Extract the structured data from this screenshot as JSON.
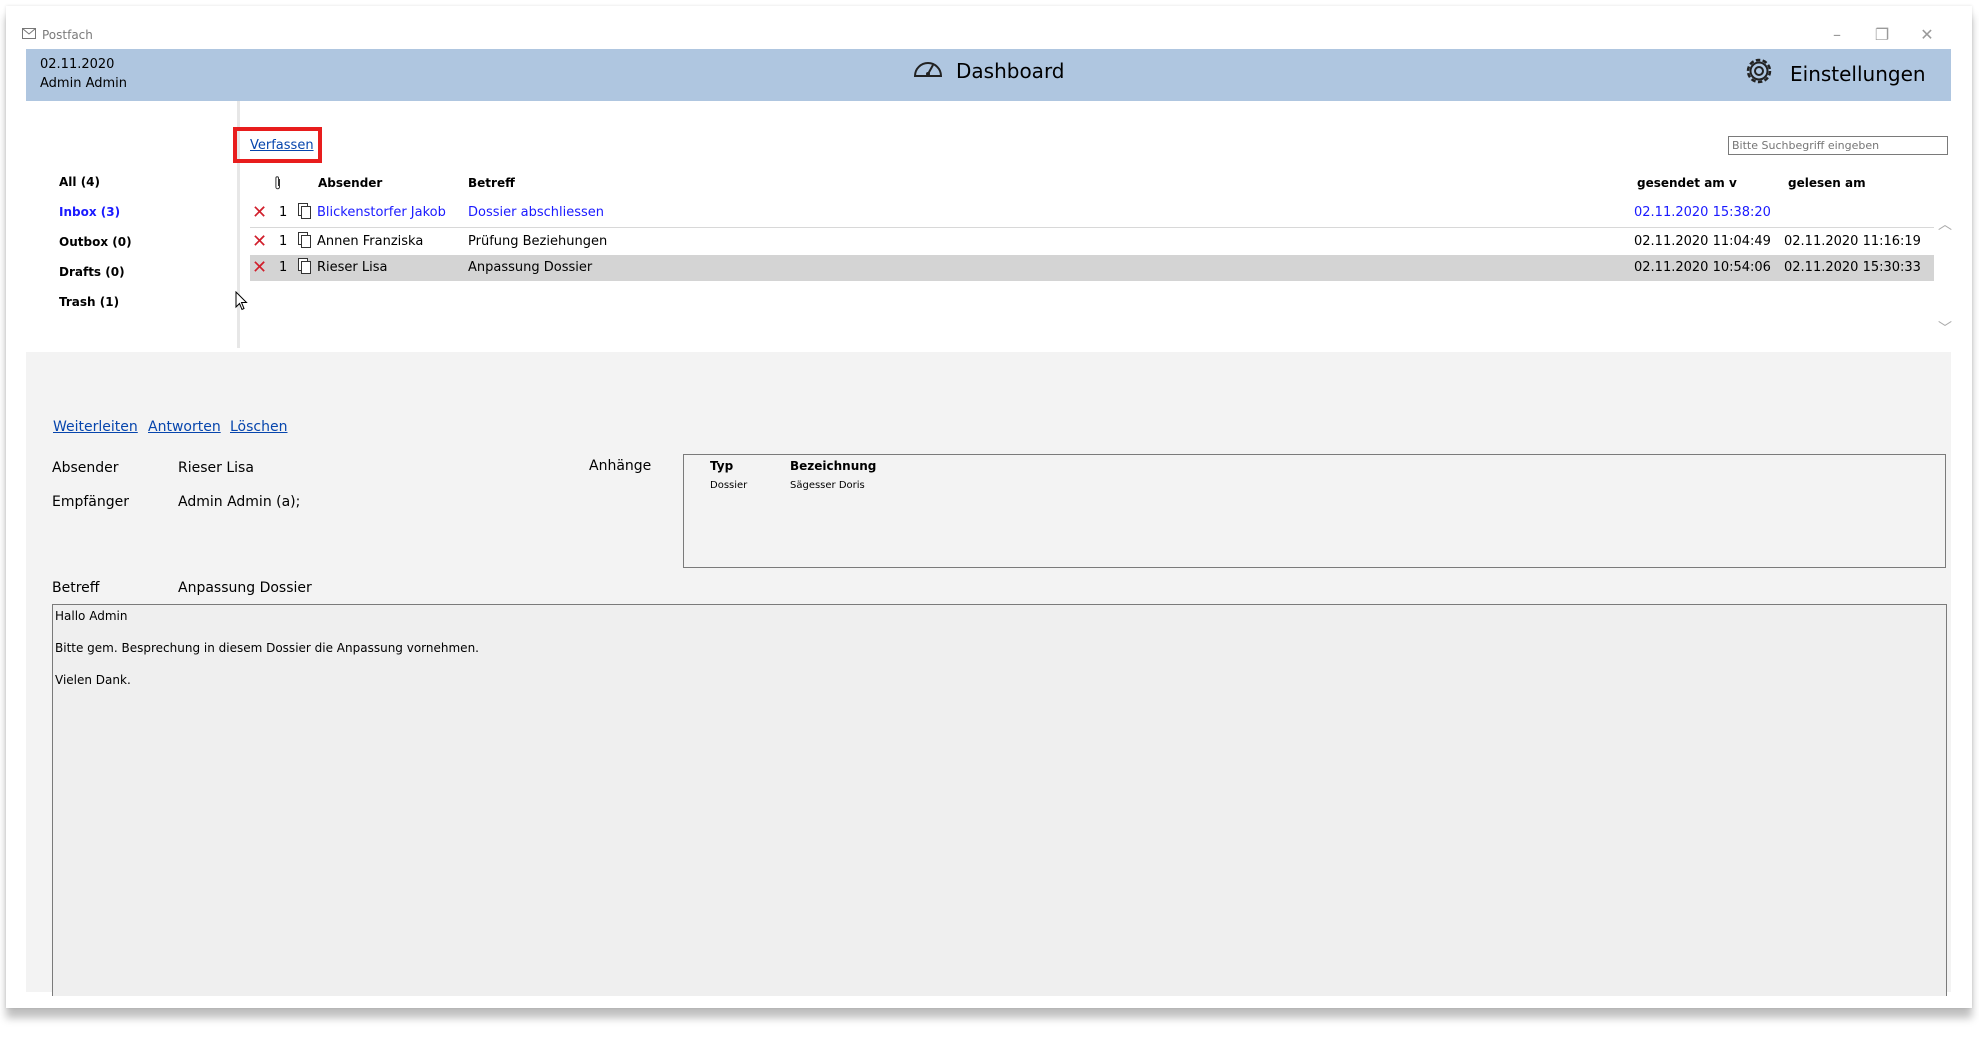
{
  "window": {
    "title": "Postfach",
    "controls": [
      "minimize-icon",
      "restore-icon",
      "close-icon"
    ]
  },
  "header": {
    "date": "02.11.2020",
    "user": "Admin Admin",
    "dashboard_label": "Dashboard",
    "settings_label": "Einstellungen"
  },
  "folders": [
    {
      "label": "All (4)",
      "active": false
    },
    {
      "label": "Inbox (3)",
      "active": true
    },
    {
      "label": "Outbox (0)",
      "active": false
    },
    {
      "label": "Drafts (0)",
      "active": false
    },
    {
      "label": "Trash (1)",
      "active": false
    }
  ],
  "compose_label": "Verfassen",
  "search_placeholder": "Bitte Suchbegriff eingeben",
  "table": {
    "columns": {
      "attachment": "attachment-icon",
      "sender": "Absender",
      "subject": "Betreff",
      "sent": "gesendet am v",
      "read": "gelesen am"
    },
    "rows": [
      {
        "count": "1",
        "sender": "Blickenstorfer Jakob",
        "subject": "Dossier abschliessen",
        "sent": "02.11.2020 15:38:20",
        "read": "",
        "unread": true,
        "selected": false
      },
      {
        "count": "1",
        "sender": "Annen Franziska",
        "subject": "Prüfung Beziehungen",
        "sent": "02.11.2020 11:04:49",
        "read": "02.11.2020 11:16:19",
        "unread": false,
        "selected": false
      },
      {
        "count": "1",
        "sender": "Rieser Lisa",
        "subject": "Anpassung Dossier",
        "sent": "02.11.2020 10:54:06",
        "read": "02.11.2020 15:30:33",
        "unread": false,
        "selected": true
      }
    ]
  },
  "actions": {
    "forward": "Weiterleiten",
    "reply": "Antworten",
    "delete": "Löschen"
  },
  "detail": {
    "sender_label": "Absender",
    "sender_value": "Rieser Lisa",
    "recipient_label": "Empfänger",
    "recipient_value": "Admin Admin (a);",
    "attachments_label": "Anhänge",
    "attachments_columns": {
      "type": "Typ",
      "name": "Bezeichnung"
    },
    "attachments": [
      {
        "type": "Dossier",
        "name": "Sägesser Doris"
      }
    ],
    "subject_label": "Betreff",
    "subject_value": "Anpassung Dossier",
    "body_lines": [
      "Hallo Admin",
      "Bitte gem. Besprechung in diesem Dossier die Anpassung vornehmen.",
      "Vielen Dank."
    ]
  },
  "colors": {
    "header_bg": "#afc6e0",
    "unread_text": "#1a1aff",
    "link": "#0645ad",
    "delete_icon": "#d11f2c",
    "highlight_border": "#e81d1d",
    "selected_row": "#d4d4d4"
  }
}
